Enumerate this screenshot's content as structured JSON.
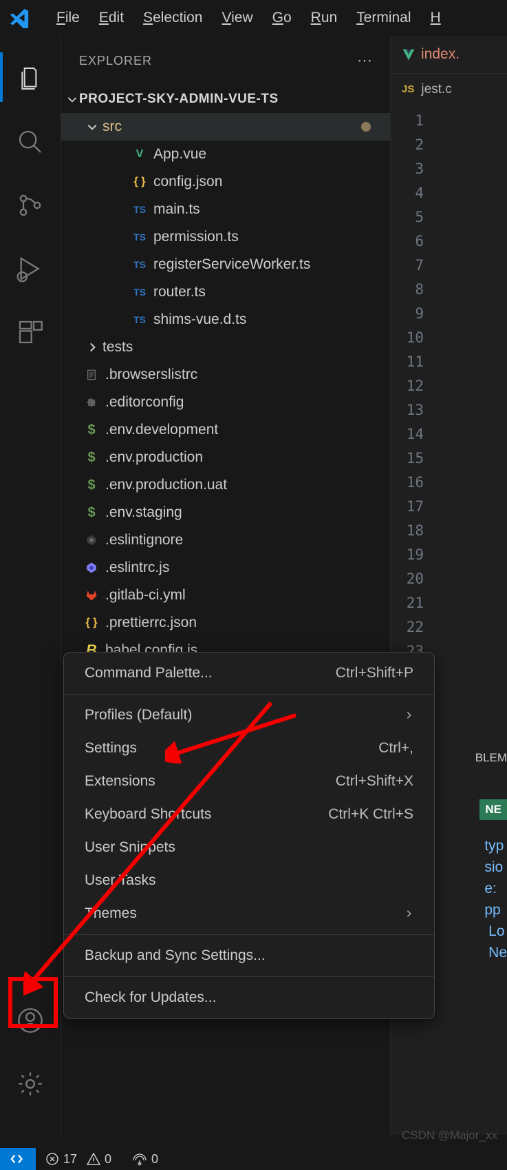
{
  "menubar": {
    "items": [
      "File",
      "Edit",
      "Selection",
      "View",
      "Go",
      "Run",
      "Terminal",
      "H"
    ]
  },
  "sidebar": {
    "title": "EXPLORER",
    "project": "PROJECT-SKY-ADMIN-VUE-TS",
    "src_label": "src",
    "files": [
      {
        "icon": "vue",
        "label": "App.vue"
      },
      {
        "icon": "json",
        "label": "config.json"
      },
      {
        "icon": "ts",
        "label": "main.ts"
      },
      {
        "icon": "ts",
        "label": "permission.ts"
      },
      {
        "icon": "ts",
        "label": "registerServiceWorker.ts"
      },
      {
        "icon": "ts",
        "label": "router.ts"
      },
      {
        "icon": "ts",
        "label": "shims-vue.d.ts"
      }
    ],
    "tests_label": "tests",
    "root_files": [
      {
        "icon": "text",
        "label": ".browserslistrc"
      },
      {
        "icon": "gear",
        "label": ".editorconfig"
      },
      {
        "icon": "dollar",
        "label": ".env.development"
      },
      {
        "icon": "dollar",
        "label": ".env.production"
      },
      {
        "icon": "dollar",
        "label": ".env.production.uat"
      },
      {
        "icon": "dollar",
        "label": ".env.staging"
      },
      {
        "icon": "ring",
        "label": ".eslintignore"
      },
      {
        "icon": "hex",
        "label": ".eslintrc.js"
      },
      {
        "icon": "gitlab",
        "label": ".gitlab-ci.yml"
      },
      {
        "icon": "json",
        "label": ".prettierrc.json"
      },
      {
        "icon": "babel",
        "label": "babel.config.js"
      }
    ]
  },
  "editor": {
    "tab1_name": "index.",
    "tab2_icon": "JS",
    "tab2_name": "jest.c",
    "line_count": 23,
    "problems_label": "BLEM",
    "outline_label": "NE",
    "code_lines": [
      "typ",
      "sio",
      "e:",
      "",
      "pp",
      " Lo",
      " Ne"
    ]
  },
  "context_menu": {
    "items": [
      {
        "label": "Command Palette...",
        "shortcut": "Ctrl+Shift+P"
      },
      {
        "sep": true
      },
      {
        "label": "Profiles (Default)",
        "submenu": true
      },
      {
        "label": "Settings",
        "shortcut": "Ctrl+,"
      },
      {
        "label": "Extensions",
        "shortcut": "Ctrl+Shift+X"
      },
      {
        "label": "Keyboard Shortcuts",
        "shortcut": "Ctrl+K Ctrl+S"
      },
      {
        "label": "User Snippets"
      },
      {
        "label": "User Tasks"
      },
      {
        "label": "Themes",
        "submenu": true
      },
      {
        "sep": true
      },
      {
        "label": "Backup and Sync Settings..."
      },
      {
        "sep": true
      },
      {
        "label": "Check for Updates..."
      }
    ]
  },
  "statusbar": {
    "errors": "17",
    "warnings": "0",
    "ports": "0"
  },
  "watermark": "CSDN @Major_xx"
}
